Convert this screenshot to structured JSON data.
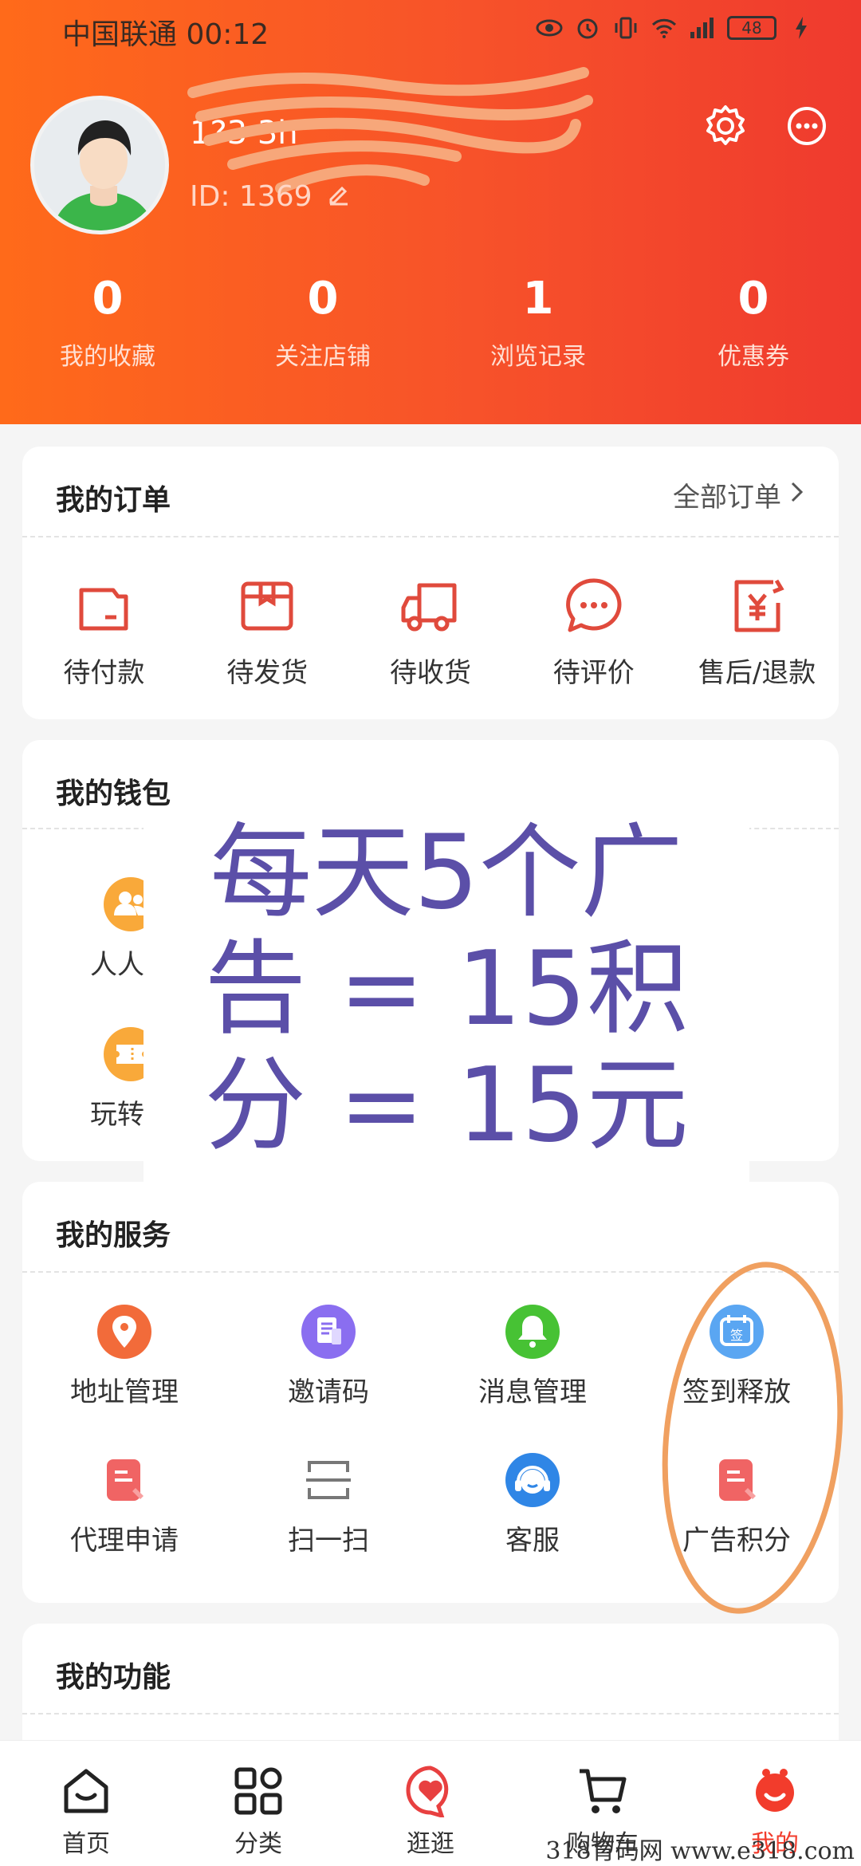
{
  "status": {
    "carrier": "中国联通 00:12",
    "battery": "48"
  },
  "profile": {
    "nickname": "1?3 3h",
    "user_id": "ID: 1369"
  },
  "stats": [
    {
      "value": "0",
      "label": "我的收藏"
    },
    {
      "value": "0",
      "label": "关注店铺"
    },
    {
      "value": "1",
      "label": "浏览记录"
    },
    {
      "value": "0",
      "label": "优惠券"
    }
  ],
  "orders": {
    "title": "我的订单",
    "all_label": "全部订单",
    "items": [
      {
        "label": "待付款",
        "icon": "wallet-icon"
      },
      {
        "label": "待发货",
        "icon": "box-icon"
      },
      {
        "label": "待收货",
        "icon": "truck-icon"
      },
      {
        "label": "待评价",
        "icon": "chat-icon"
      },
      {
        "label": "售后/退款",
        "icon": "yen-refund-icon"
      }
    ]
  },
  "wallet": {
    "title": "我的钱包",
    "items": [
      {
        "label": "人人创",
        "icon": "people-icon"
      },
      {
        "label": "玩转积",
        "icon": "ticket-icon"
      }
    ]
  },
  "overlay_text": [
    "每天5个广",
    "告 = 15积",
    "分 = 15元"
  ],
  "services": {
    "title": "我的服务",
    "items": [
      {
        "label": "地址管理",
        "icon": "location-icon"
      },
      {
        "label": "邀请码",
        "icon": "invite-icon"
      },
      {
        "label": "消息管理",
        "icon": "bell-icon"
      },
      {
        "label": "签到释放",
        "icon": "sign-in-icon"
      },
      {
        "label": "代理申请",
        "icon": "document-icon"
      },
      {
        "label": "扫一扫",
        "icon": "scan-icon"
      },
      {
        "label": "客服",
        "icon": "headset-icon"
      },
      {
        "label": "广告积分",
        "icon": "document-icon"
      }
    ]
  },
  "functions": {
    "title": "我的功能"
  },
  "tabs": [
    {
      "label": "首页",
      "icon": "home-icon"
    },
    {
      "label": "分类",
      "icon": "grid-icon"
    },
    {
      "label": "逛逛",
      "icon": "heart-icon"
    },
    {
      "label": "购物车",
      "icon": "cart-icon"
    },
    {
      "label": "我的",
      "icon": "profile-icon",
      "active": true
    }
  ],
  "watermark": "318育码网 www.e318.com",
  "colors": {
    "brand_gradient_start": "#ff6a1a",
    "brand_gradient_end": "#ef3a2e",
    "order_icon_red": "#e04a3c",
    "active_tab": "#f23c2c",
    "overlay_text": "#5b4fa8",
    "annotation_orange": "#f0a060"
  }
}
